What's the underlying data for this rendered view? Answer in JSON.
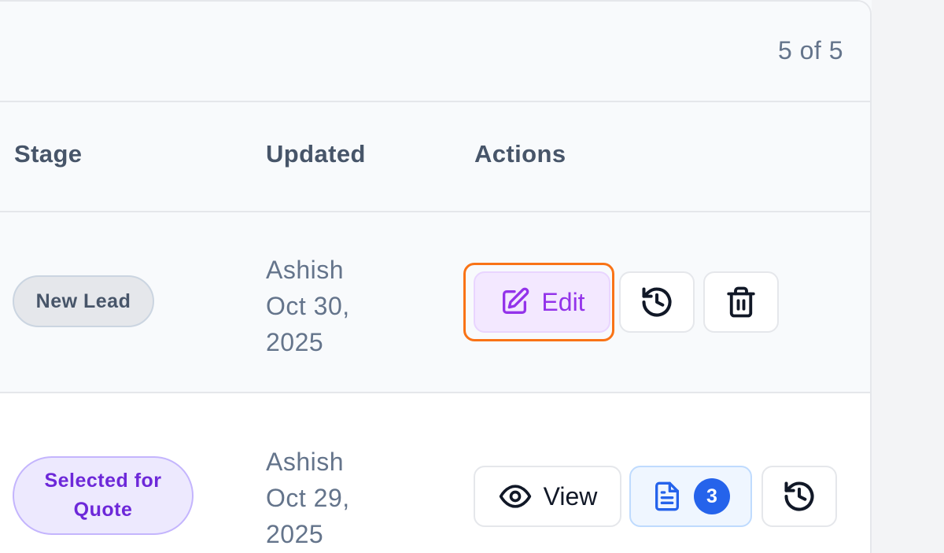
{
  "pagination": {
    "count_text": "5 of 5"
  },
  "table": {
    "headers": {
      "stage": "Stage",
      "updated": "Updated",
      "actions": "Actions"
    },
    "rows": [
      {
        "stage": "New Lead",
        "updated_by": "Ashish",
        "updated_date_line1": "Oct 30,",
        "updated_date_line2": "2025",
        "actions": {
          "edit_label": "Edit",
          "history_icon": "history-icon",
          "delete_icon": "trash-icon"
        }
      },
      {
        "stage": "Selected for Quote",
        "updated_by": "Ashish",
        "updated_date_line1": "Oct 29,",
        "updated_date_line2": "2025",
        "actions": {
          "view_label": "View",
          "documents_count": "3",
          "document_icon": "document-icon",
          "history_icon": "history-icon"
        }
      }
    ]
  },
  "colors": {
    "accent_orange": "#f97316",
    "edit_purple": "#9333ea",
    "badge_blue": "#2563eb",
    "quote_purple": "#6d28d9"
  }
}
